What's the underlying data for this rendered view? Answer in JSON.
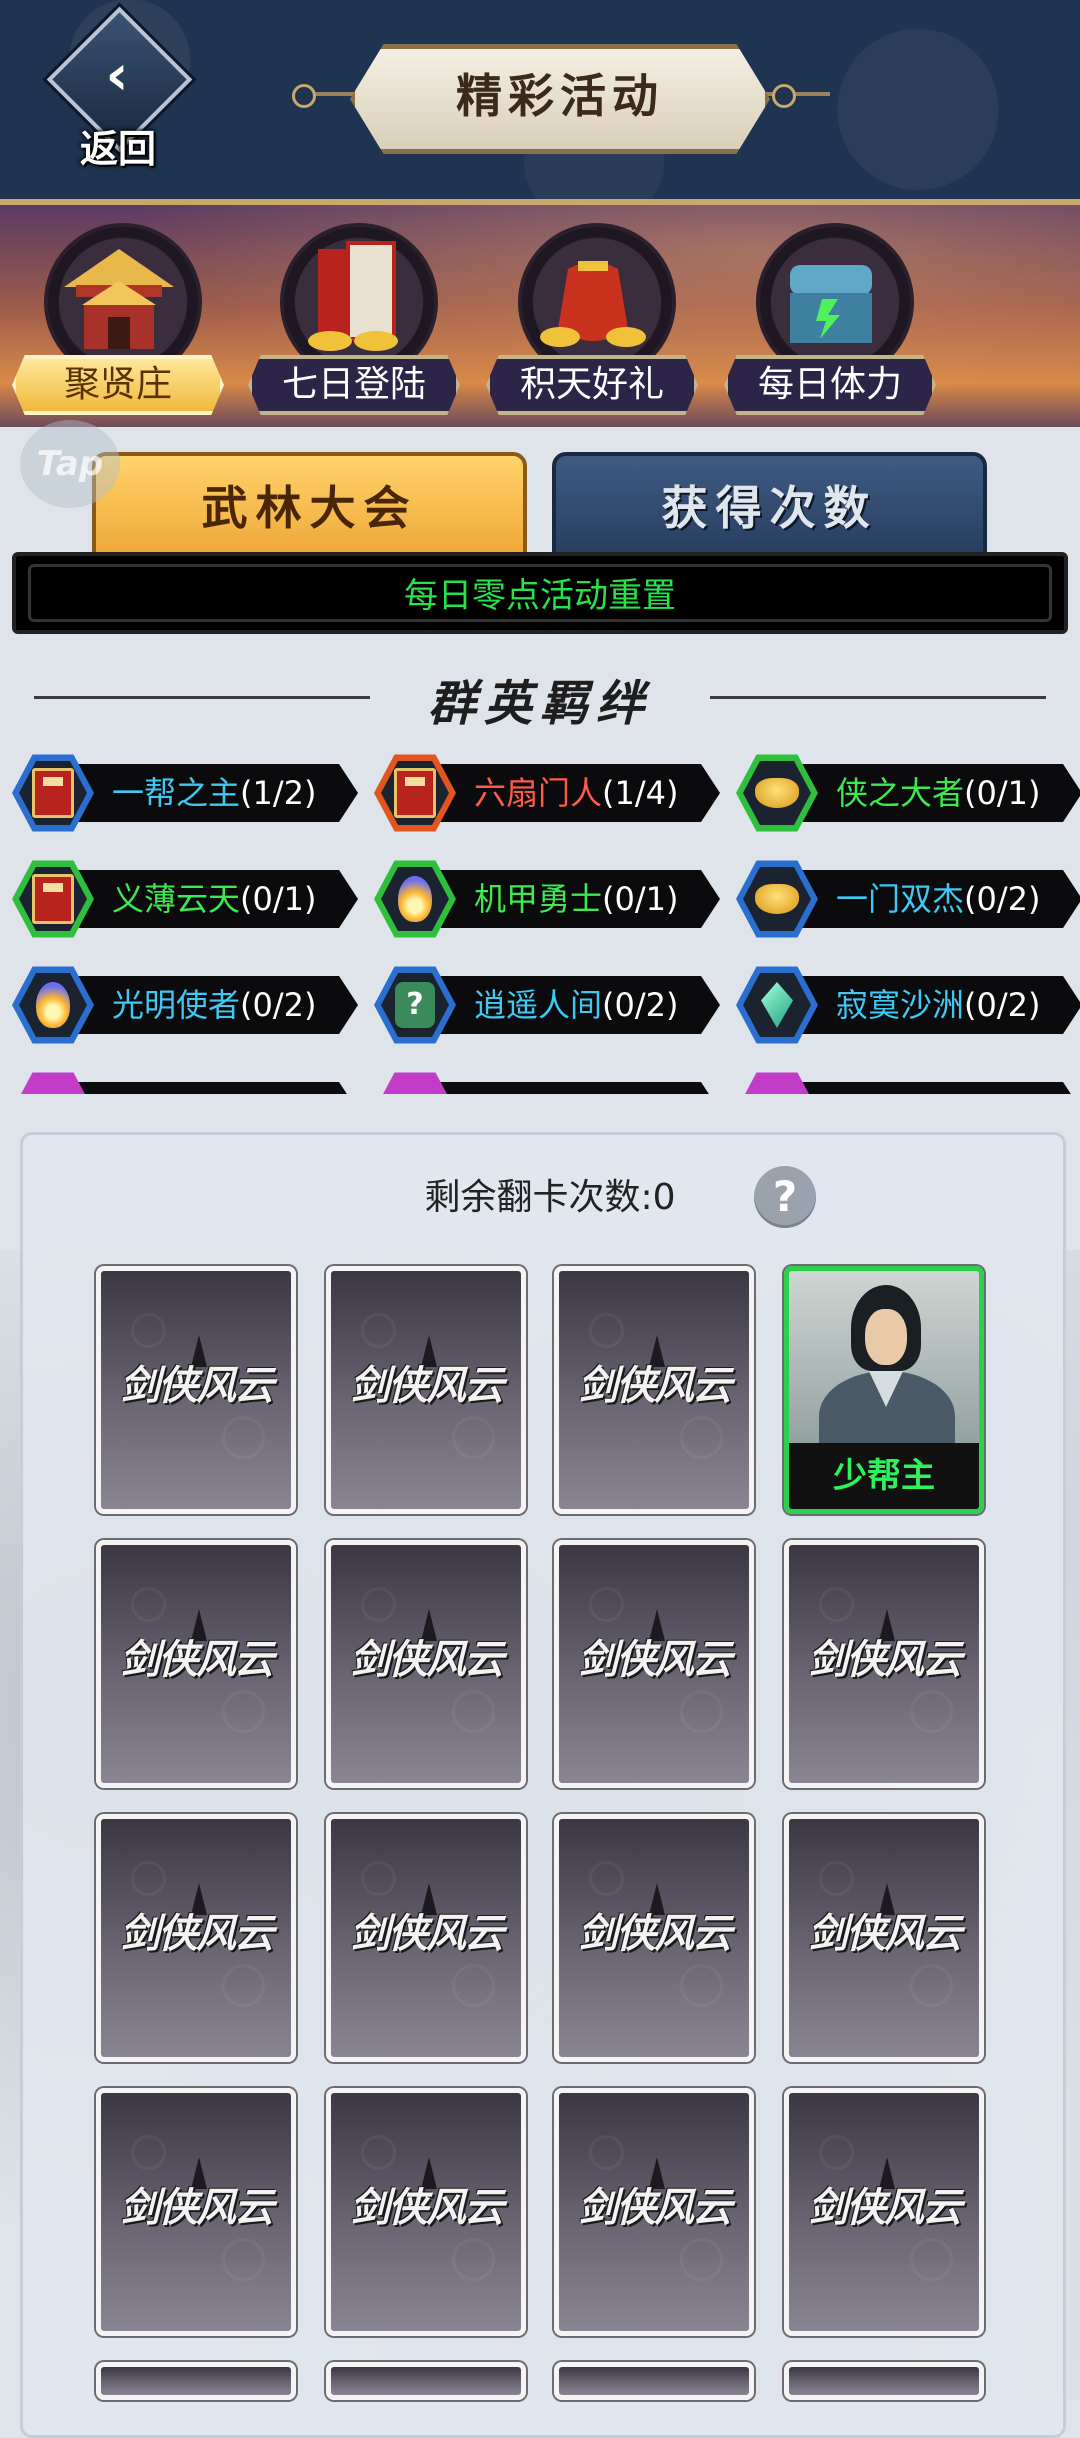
{
  "header": {
    "back_label": "返回",
    "title": "精彩活动"
  },
  "activities": [
    {
      "label": "聚贤庄",
      "icon": "pavilion-icon",
      "active": true
    },
    {
      "label": "七日登陆",
      "icon": "scroll-books-icon",
      "active": false
    },
    {
      "label": "积天好礼",
      "icon": "money-bag-icon",
      "active": false
    },
    {
      "label": "每日体力",
      "icon": "treasure-chest-icon",
      "active": false
    }
  ],
  "tap_badge": "Tap",
  "tabs": [
    {
      "label": "武林大会",
      "active": true
    },
    {
      "label": "获得次数",
      "active": false
    }
  ],
  "notice": "每日零点活动重置",
  "bonds_title": "群英羁绊",
  "bonds": [
    {
      "name": "一帮之主",
      "count": "(1/2)",
      "icon": "red-book-icon",
      "name_color": "#3fc9f2",
      "frame": "#2a6fd0"
    },
    {
      "name": "六扇门人",
      "count": "(1/4)",
      "icon": "red-book-icon",
      "name_color": "#ff5a4a",
      "frame": "#e0561e"
    },
    {
      "name": "侠之大者",
      "count": "(0/1)",
      "icon": "gold-ingot-icon",
      "name_color": "#3ee84f",
      "frame": "#2fbf3c"
    },
    {
      "name": "义薄云天",
      "count": "(0/1)",
      "icon": "red-book-icon",
      "name_color": "#3ee84f",
      "frame": "#2fbf3c"
    },
    {
      "name": "机甲勇士",
      "count": "(0/1)",
      "icon": "flame-orb-icon",
      "name_color": "#3ee84f",
      "frame": "#2fbf3c"
    },
    {
      "name": "一门双杰",
      "count": "(0/2)",
      "icon": "gold-ingot-icon",
      "name_color": "#3fc9f2",
      "frame": "#2a6fd0"
    },
    {
      "name": "光明使者",
      "count": "(0/2)",
      "icon": "flame-orb-icon",
      "name_color": "#3fc9f2",
      "frame": "#2a6fd0"
    },
    {
      "name": "逍遥人间",
      "count": "(0/2)",
      "icon": "mystery-box-icon",
      "name_color": "#3fc9f2",
      "frame": "#2a6fd0"
    },
    {
      "name": "寂寞沙洲",
      "count": "(0/2)",
      "icon": "jade-gem-icon",
      "name_color": "#3fc9f2",
      "frame": "#2a6fd0"
    }
  ],
  "remaining_flips": "剩余翻卡次数:0",
  "help_label": "?",
  "card_back_logo": "剑侠风云",
  "revealed_card": {
    "name": "少帮主",
    "row": 0,
    "col": 3
  },
  "card_rows": 4,
  "card_cols": 4
}
